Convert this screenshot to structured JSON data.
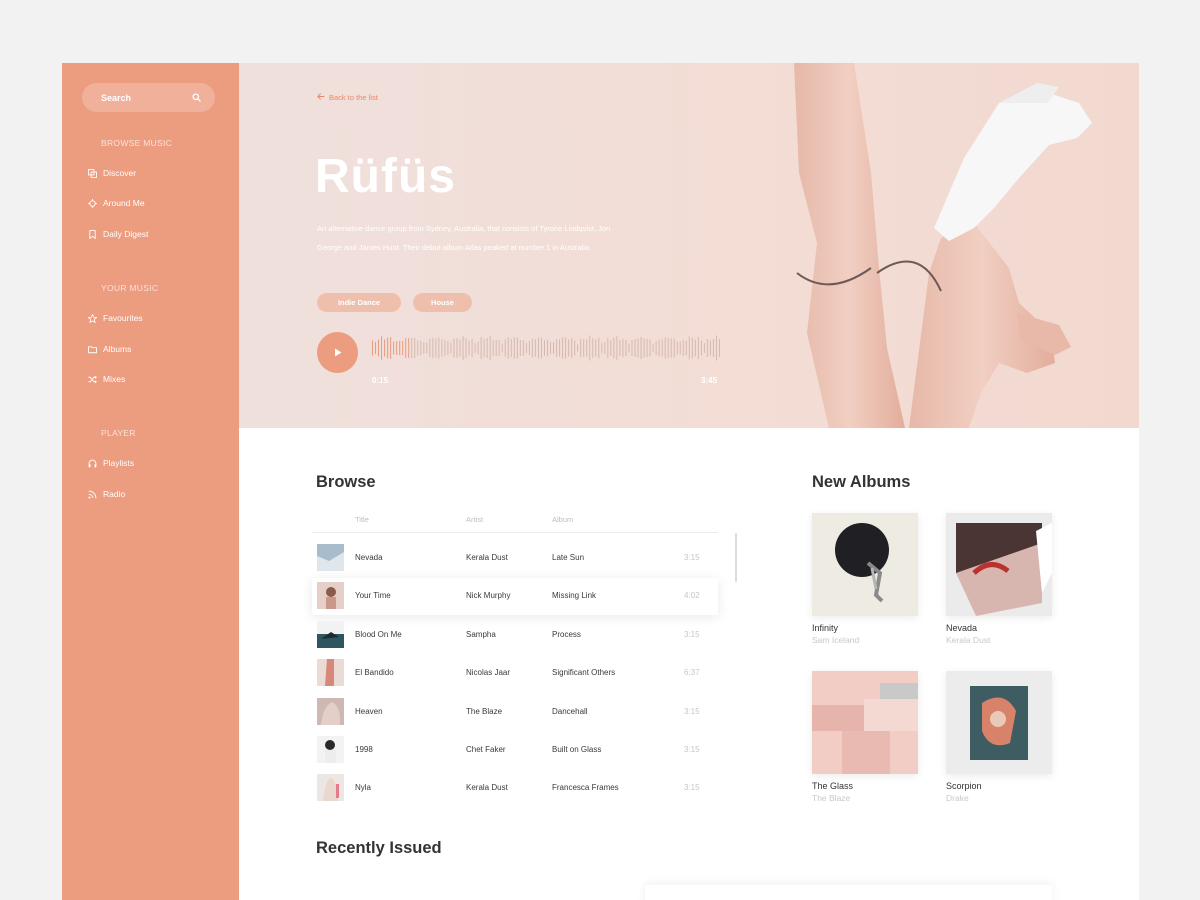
{
  "sidebar": {
    "search_label": "Search",
    "sections": [
      {
        "title": "BROWSE MUSIC",
        "items": [
          {
            "label": "Discover",
            "icon": "discover-icon"
          },
          {
            "label": "Around Me",
            "icon": "target-icon"
          },
          {
            "label": "Daily Digest",
            "icon": "bookmark-icon"
          }
        ]
      },
      {
        "title": "YOUR MUSIC",
        "items": [
          {
            "label": "Favourites",
            "icon": "star-icon"
          },
          {
            "label": "Albums",
            "icon": "folder-icon"
          },
          {
            "label": "Mixes",
            "icon": "shuffle-icon"
          }
        ]
      },
      {
        "title": "PLAYER",
        "items": [
          {
            "label": "Playlists",
            "icon": "headphones-icon"
          },
          {
            "label": "Radio",
            "icon": "rss-icon"
          }
        ]
      }
    ]
  },
  "hero": {
    "back_label": "Back to the list",
    "artist": "Rüfüs",
    "bio": "An alternative dance group from Sydney, Australia, that consists of Tyrone Lindqvist, Jon George and James Hunt. Their debut album Atlas peaked at number 1 in Australia.",
    "tags": [
      "Indie Dance",
      "House"
    ],
    "elapsed": "0:15",
    "duration": "3:45",
    "progress": 0.11
  },
  "browse": {
    "title": "Browse",
    "columns": [
      "Title",
      "Artist",
      "Album"
    ],
    "rows": [
      {
        "title": "Nevada",
        "artist": "Kerala Dust",
        "album": "Late Sun",
        "duration": "3:15"
      },
      {
        "title": "Your Time",
        "artist": "Nick Murphy",
        "album": "Missing Link",
        "duration": "4:02"
      },
      {
        "title": "Blood On Me",
        "artist": "Sampha",
        "album": "Process",
        "duration": "3:15"
      },
      {
        "title": "El Bandido",
        "artist": "Nicolas Jaar",
        "album": "Significant Others",
        "duration": "6:37"
      },
      {
        "title": "Heaven",
        "artist": "The Blaze",
        "album": "Dancehall",
        "duration": "3:15"
      },
      {
        "title": "1998",
        "artist": "Chet Faker",
        "album": "Built on Glass",
        "duration": "3:15"
      },
      {
        "title": "Nyla",
        "artist": "Kerala Dust",
        "album": "Francesca Frames",
        "duration": "3:15"
      }
    ]
  },
  "albums": {
    "title": "New Albums",
    "items": [
      {
        "title": "Infinity",
        "artist": "Sam Iceland"
      },
      {
        "title": "Nevada",
        "artist": "Kerala Dust"
      },
      {
        "title": "The Glass",
        "artist": "The Blaze"
      },
      {
        "title": "Scorpion",
        "artist": "Drake"
      }
    ]
  },
  "recent": {
    "title": "Recently Issued"
  },
  "colors": {
    "accent": "#ec9c7f",
    "sidebar": "#ec9c7f",
    "page_bg": "#f2f2f2"
  }
}
